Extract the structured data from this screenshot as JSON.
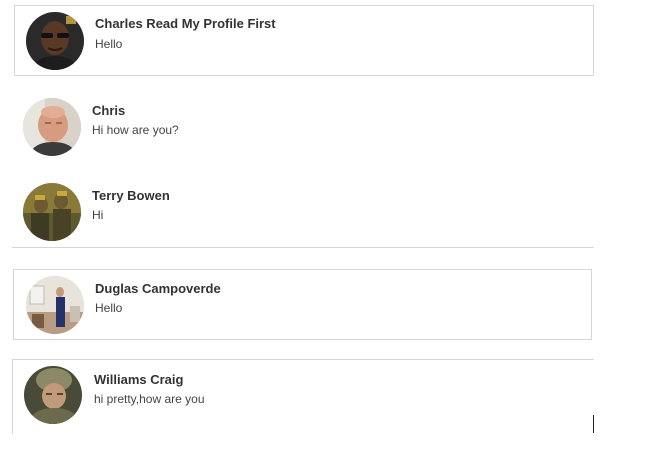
{
  "conversations": [
    {
      "name": "Charles Read My Profile First",
      "preview": "Hello",
      "avatar": "avatar-man-dark-skin-glasses",
      "avatar_colors": {
        "bg": "#2a2a2a",
        "skin": "#5a3826",
        "shirt": "#1d1d1d",
        "accent": "#b8923c"
      }
    },
    {
      "name": "Chris",
      "preview": "Hi how are you?",
      "avatar": "avatar-man-bald",
      "avatar_colors": {
        "bg": "#d8d2c8",
        "skin": "#d79c80",
        "shirt": "#3b3b3b",
        "accent": "#a06a55"
      }
    },
    {
      "name": "Terry Bowen",
      "preview": "Hi",
      "avatar": "avatar-soldier-group",
      "avatar_colors": {
        "bg": "#8a7a3a",
        "skin": "#6b5a32",
        "shirt": "#3f3a24",
        "accent": "#c9a93e"
      }
    },
    {
      "name": "Duglas Campoverde",
      "preview": "Hello",
      "avatar": "avatar-person-standing-room",
      "avatar_colors": {
        "bg": "#e8e4dc",
        "skin": "#c49a7c",
        "shirt": "#25326a",
        "accent": "#7a5a42"
      }
    },
    {
      "name": "Williams Craig",
      "preview": "hi pretty,how are you",
      "avatar": "avatar-soldier-helmet",
      "avatar_colors": {
        "bg": "#4a4a38",
        "skin": "#c09a7a",
        "shirt": "#6b6a4c",
        "accent": "#8c8a66"
      }
    }
  ]
}
